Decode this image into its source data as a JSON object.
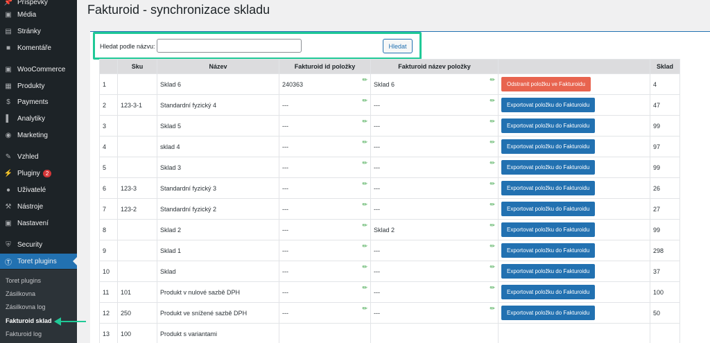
{
  "sidebar": {
    "items": [
      {
        "label": "Příspěvky",
        "icon": "pin-icon"
      },
      {
        "label": "Média",
        "icon": "media-icon"
      },
      {
        "label": "Stránky",
        "icon": "pages-icon"
      },
      {
        "label": "Komentáře",
        "icon": "comments-icon"
      },
      {
        "label": "WooCommerce",
        "icon": "woocommerce-icon"
      },
      {
        "label": "Produkty",
        "icon": "products-icon"
      },
      {
        "label": "Payments",
        "icon": "payments-icon"
      },
      {
        "label": "Analytiky",
        "icon": "analytics-icon"
      },
      {
        "label": "Marketing",
        "icon": "marketing-icon"
      },
      {
        "label": "Vzhled",
        "icon": "appearance-icon"
      },
      {
        "label": "Pluginy",
        "icon": "plugins-icon",
        "badge": "2"
      },
      {
        "label": "Uživatelé",
        "icon": "users-icon"
      },
      {
        "label": "Nástroje",
        "icon": "tools-icon"
      },
      {
        "label": "Nastavení",
        "icon": "settings-icon"
      },
      {
        "label": "Security",
        "icon": "shield-icon"
      },
      {
        "label": "Toret plugins",
        "icon": "toret-icon",
        "active": true
      }
    ],
    "submenu": [
      "Toret plugins",
      "Zásilkovna",
      "Zásilkovna log",
      "Fakturoid sklad",
      "Fakturoid log"
    ],
    "current_submenu": "Fakturoid sklad"
  },
  "page": {
    "title": "Fakturoid - synchronizace skladu",
    "search_label": "Hledat podle názvu:",
    "search_value": "",
    "search_button": "Hledat"
  },
  "table": {
    "headers": [
      "",
      "Sku",
      "Název",
      "Fakturoid id položky",
      "Fakturoid název položky",
      "",
      "Sklad"
    ],
    "rows": [
      {
        "num": "1",
        "sku": "",
        "name": "Sklad 6",
        "fid": "240363",
        "fname": "Sklad 6",
        "action": "Odstranit položku ve Fakturoidu",
        "action_type": "remove",
        "stock": "4"
      },
      {
        "num": "2",
        "sku": "123-3-1",
        "name": "Standardní fyzický 4",
        "fid": "---",
        "fname": "---",
        "action": "Exportovat položku do Fakturoidu",
        "action_type": "export",
        "stock": "47"
      },
      {
        "num": "3",
        "sku": "",
        "name": "Sklad 5",
        "fid": "---",
        "fname": "---",
        "action": "Exportovat položku do Fakturoidu",
        "action_type": "export",
        "stock": "99"
      },
      {
        "num": "4",
        "sku": "",
        "name": "sklad 4",
        "fid": "---",
        "fname": "---",
        "action": "Exportovat položku do Fakturoidu",
        "action_type": "export",
        "stock": "97"
      },
      {
        "num": "5",
        "sku": "",
        "name": "Sklad 3",
        "fid": "---",
        "fname": "---",
        "action": "Exportovat položku do Fakturoidu",
        "action_type": "export",
        "stock": "99"
      },
      {
        "num": "6",
        "sku": "123-3",
        "name": "Standardní fyzický 3",
        "fid": "---",
        "fname": "---",
        "action": "Exportovat položku do Fakturoidu",
        "action_type": "export",
        "stock": "26"
      },
      {
        "num": "7",
        "sku": "123-2",
        "name": "Standardní fyzický 2",
        "fid": "---",
        "fname": "---",
        "action": "Exportovat položku do Fakturoidu",
        "action_type": "export",
        "stock": "27"
      },
      {
        "num": "8",
        "sku": "",
        "name": "Sklad 2",
        "fid": "---",
        "fname": "Sklad 2",
        "action": "Exportovat položku do Fakturoidu",
        "action_type": "export",
        "stock": "99"
      },
      {
        "num": "9",
        "sku": "",
        "name": "Sklad 1",
        "fid": "---",
        "fname": "---",
        "action": "Exportovat položku do Fakturoidu",
        "action_type": "export",
        "stock": "298"
      },
      {
        "num": "10",
        "sku": "",
        "name": "Sklad",
        "fid": "---",
        "fname": "---",
        "action": "Exportovat položku do Fakturoidu",
        "action_type": "export",
        "stock": "37"
      },
      {
        "num": "11",
        "sku": "101",
        "name": "Produkt v nulové sazbě DPH",
        "fid": "---",
        "fname": "---",
        "action": "Exportovat položku do Fakturoidu",
        "action_type": "export",
        "stock": "100"
      },
      {
        "num": "12",
        "sku": "250",
        "name": "Produkt ve snížené sazbě DPH",
        "fid": "---",
        "fname": "---",
        "action": "Exportovat položku do Fakturoidu",
        "action_type": "export",
        "stock": "50"
      },
      {
        "num": "13",
        "sku": "100",
        "name": "Produkt s variantami",
        "fid": "",
        "fname": "",
        "action": "",
        "action_type": "none",
        "stock": ""
      }
    ]
  },
  "colors": {
    "accent": "#2271b1",
    "highlight": "#20c997",
    "remove_button": "#e8644f",
    "sidebar_bg": "#1d2327"
  }
}
